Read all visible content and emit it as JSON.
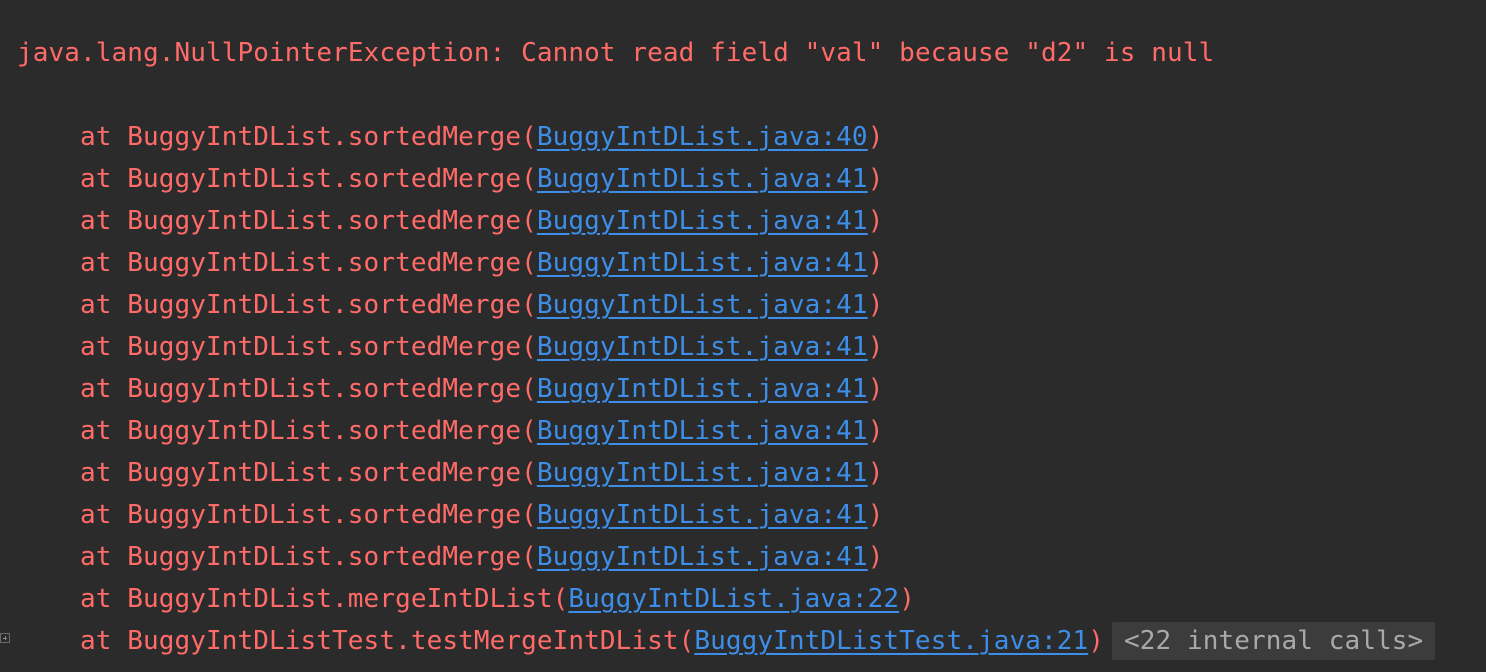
{
  "console": {
    "exception": "java.lang.NullPointerException: Cannot read field \"val\" because \"d2\" is null",
    "frames": [
      {
        "prefix": "at BuggyIntDList.sortedMerge(",
        "link": "BuggyIntDList.java:40",
        "suffix": ")"
      },
      {
        "prefix": "at BuggyIntDList.sortedMerge(",
        "link": "BuggyIntDList.java:41",
        "suffix": ")"
      },
      {
        "prefix": "at BuggyIntDList.sortedMerge(",
        "link": "BuggyIntDList.java:41",
        "suffix": ")"
      },
      {
        "prefix": "at BuggyIntDList.sortedMerge(",
        "link": "BuggyIntDList.java:41",
        "suffix": ")"
      },
      {
        "prefix": "at BuggyIntDList.sortedMerge(",
        "link": "BuggyIntDList.java:41",
        "suffix": ")"
      },
      {
        "prefix": "at BuggyIntDList.sortedMerge(",
        "link": "BuggyIntDList.java:41",
        "suffix": ")"
      },
      {
        "prefix": "at BuggyIntDList.sortedMerge(",
        "link": "BuggyIntDList.java:41",
        "suffix": ")"
      },
      {
        "prefix": "at BuggyIntDList.sortedMerge(",
        "link": "BuggyIntDList.java:41",
        "suffix": ")"
      },
      {
        "prefix": "at BuggyIntDList.sortedMerge(",
        "link": "BuggyIntDList.java:41",
        "suffix": ")"
      },
      {
        "prefix": "at BuggyIntDList.sortedMerge(",
        "link": "BuggyIntDList.java:41",
        "suffix": ")"
      },
      {
        "prefix": "at BuggyIntDList.sortedMerge(",
        "link": "BuggyIntDList.java:41",
        "suffix": ")"
      },
      {
        "prefix": "at BuggyIntDList.mergeIntDList(",
        "link": "BuggyIntDList.java:22",
        "suffix": ")"
      },
      {
        "prefix": "at BuggyIntDListTest.testMergeIntDList(",
        "link": "BuggyIntDListTest.java:21",
        "suffix": ")"
      }
    ],
    "internal_calls": "<22 internal calls>",
    "gutter_icon": "expand-fold-icon"
  },
  "colors": {
    "background": "#2b2b2b",
    "error_text": "#ff6b68",
    "link": "#3d8ee8",
    "badge_bg": "#3c3c3c",
    "badge_text": "#a9a9a9"
  }
}
